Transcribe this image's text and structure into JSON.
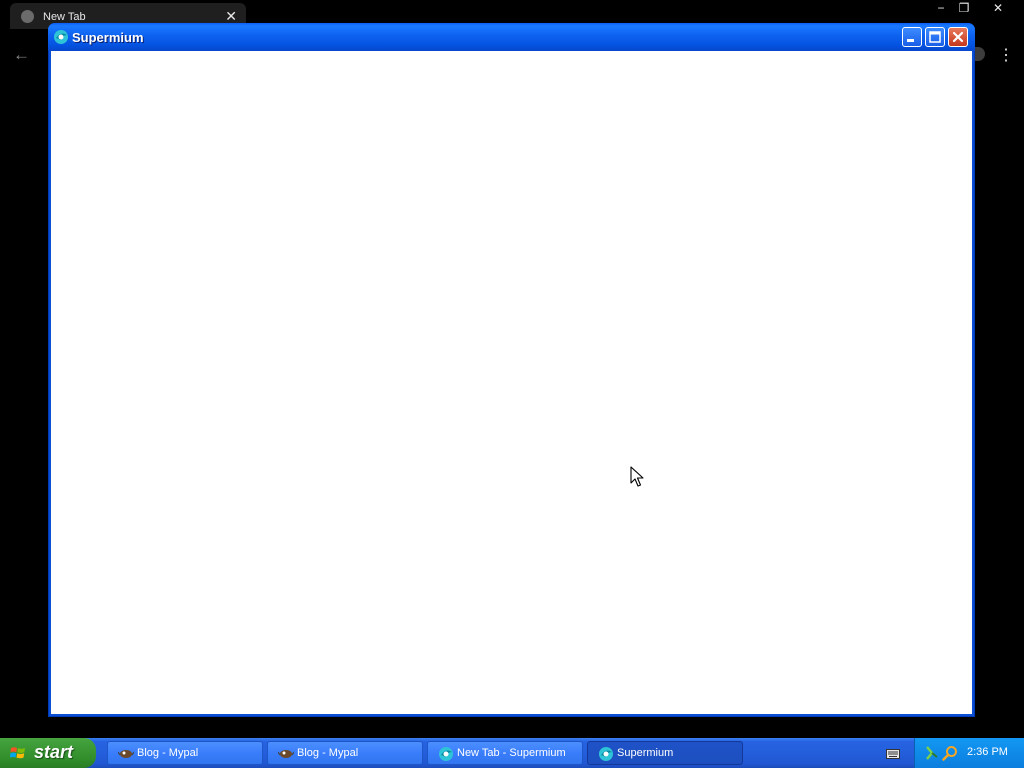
{
  "background_browser": {
    "tab_title": "New Tab",
    "tab_close": "✕",
    "window_minimize": "−",
    "window_restore": "❐",
    "window_close": "✕",
    "back": "←",
    "menu": "⋮"
  },
  "window": {
    "title": "Supermium"
  },
  "taskbar": {
    "start_label": "start",
    "buttons": [
      {
        "label": "Blog - Mypal",
        "active": false
      },
      {
        "label": "Blog - Mypal",
        "active": false
      },
      {
        "label": "New Tab - Supermium",
        "active": false
      },
      {
        "label": "Supermium",
        "active": true
      }
    ],
    "clock": "2:36 PM"
  },
  "colors": {
    "titlebar_blue": "#0a5ef5",
    "taskbar_blue": "#245edb",
    "start_green": "#3d9a37",
    "tray_blue": "#0f8ae8"
  }
}
